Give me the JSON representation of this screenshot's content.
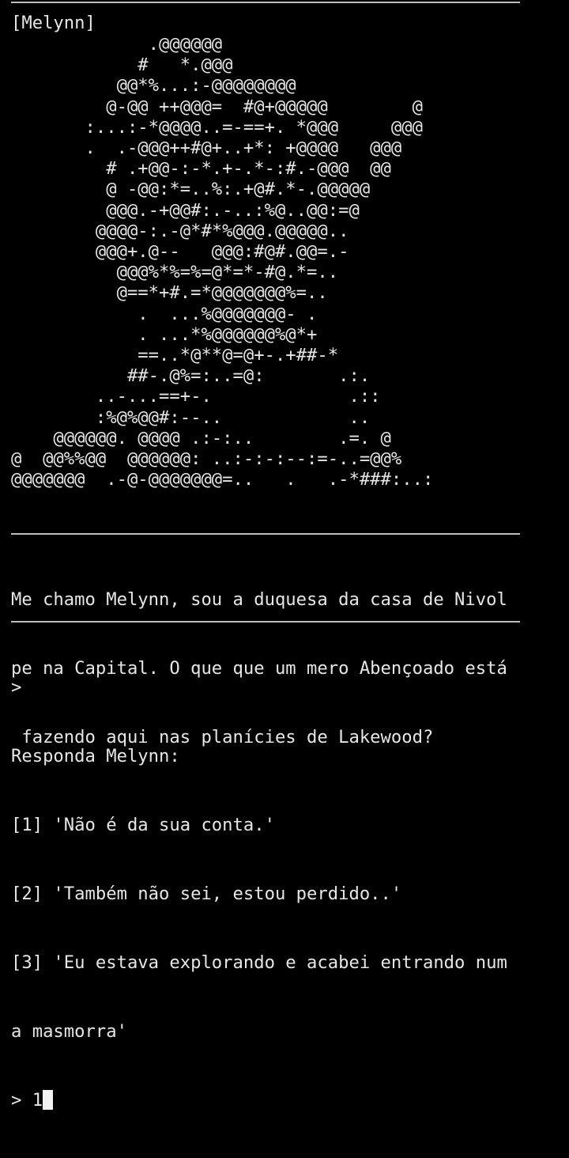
{
  "speaker": "[Melynn]",
  "ascii_art": [
    "             .@@@@@@",
    "            #   *.@@@",
    "          @@*%...:-@@@@@@@@",
    "         @-@@ ++@@@=  #@+@@@@@        @",
    "       :...:-*@@@@..=-==+. *@@@     @@@",
    "       .  .-@@@++#@+..+*: +@@@@   @@@",
    "         # .+@@-:-*.+-.*-:#.-@@@  @@",
    "         @ -@@:*=..%:.+@#.*-.@@@@@",
    "         @@@.-+@@#:.-..:%@..@@:=@",
    "        @@@@-:.-@*#*%@@@.@@@@@..",
    "        @@@+.@--   @@@:#@#.@@=.-",
    "          @@@%*%=%=@*=*-#@.*=..",
    "          @==*+#.=*@@@@@@@%=..",
    "            .  ...%@@@@@@@- .",
    "            . ...*%@@@@@@%@*+",
    "            ==..*@**@=@+-.+##-*",
    "           ##-.@%=:..=@:       .:.",
    "        ..-...==+-.             .::",
    "        :%@%@@#:--..            ..",
    "    @@@@@@. @@@@ .:-:..        .=. @",
    "@  @@%%@@  @@@@@@: ..:-:-:--:=-..=@@%",
    "@@@@@@@  .-@-@@@@@@@=..   .   .-*###:..:"
  ],
  "dialogue": [
    "Me chamo Melynn, sou a duquesa da casa de Nivol",
    "pe na Capital. O que que um mero Abençoado está",
    " fazendo aqui nas planícies de Lakewood?"
  ],
  "prompt_echo": ">",
  "response_header": "Responda Melynn:",
  "options": [
    "[1] 'Não é da sua conta.'",
    "[2] 'Também não sei, estou perdido..'",
    "[3] 'Eu estava explorando e acabei entrando num",
    "a masmorra'"
  ],
  "input": {
    "prompt": "> ",
    "value": "1"
  },
  "colors": {
    "background": "#000000",
    "text": "#e6e6e6",
    "rule": "#bdbdbd",
    "cursor": "#f2f2f2"
  }
}
